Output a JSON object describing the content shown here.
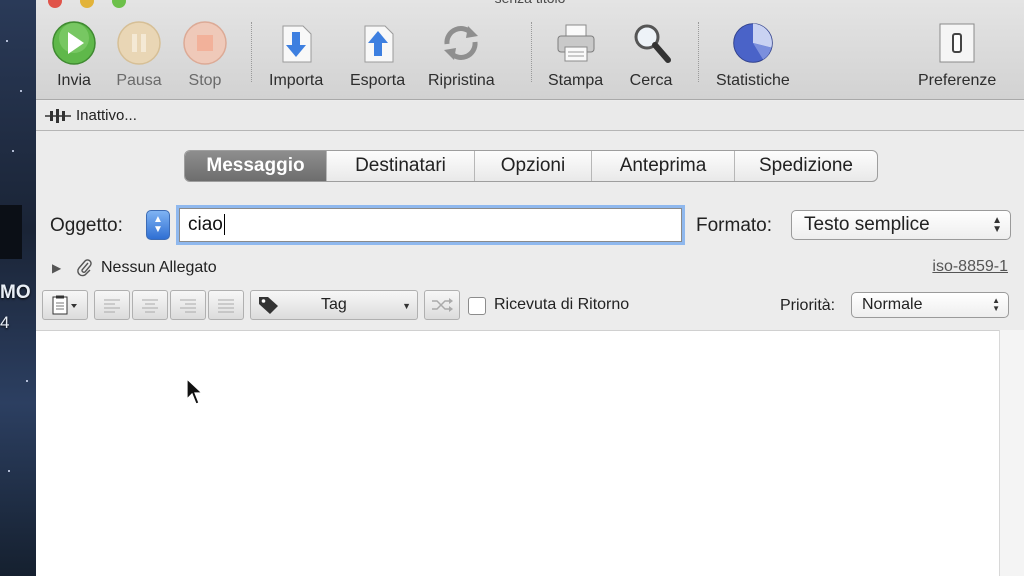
{
  "window": {
    "title": "senza titolo"
  },
  "desktop": {
    "text1": "MO",
    "text2": "4"
  },
  "toolbar": {
    "invia": "Invia",
    "pausa": "Pausa",
    "stop": "Stop",
    "importa": "Importa",
    "esporta": "Esporta",
    "ripristina": "Ripristina",
    "stampa": "Stampa",
    "cerca": "Cerca",
    "statistiche": "Statistiche",
    "preferenze": "Preferenze"
  },
  "status": {
    "text": "Inattivo..."
  },
  "tabs": [
    "Messaggio",
    "Destinatari",
    "Opzioni",
    "Anteprima",
    "Spedizione"
  ],
  "form": {
    "oggetto_label": "Oggetto:",
    "oggetto_value": "ciao",
    "formato_label": "Formato:",
    "formato_value": "Testo semplice",
    "allegato": "Nessun Allegato",
    "charset": "iso-8859-1",
    "tag_label": "Tag",
    "ricevuta": "Ricevuta di Ritorno",
    "priorita_label": "Priorità:",
    "priorita_value": "Normale"
  },
  "colors": {
    "accent": "#3478d6",
    "selected_tab": "#7a7a7a"
  }
}
